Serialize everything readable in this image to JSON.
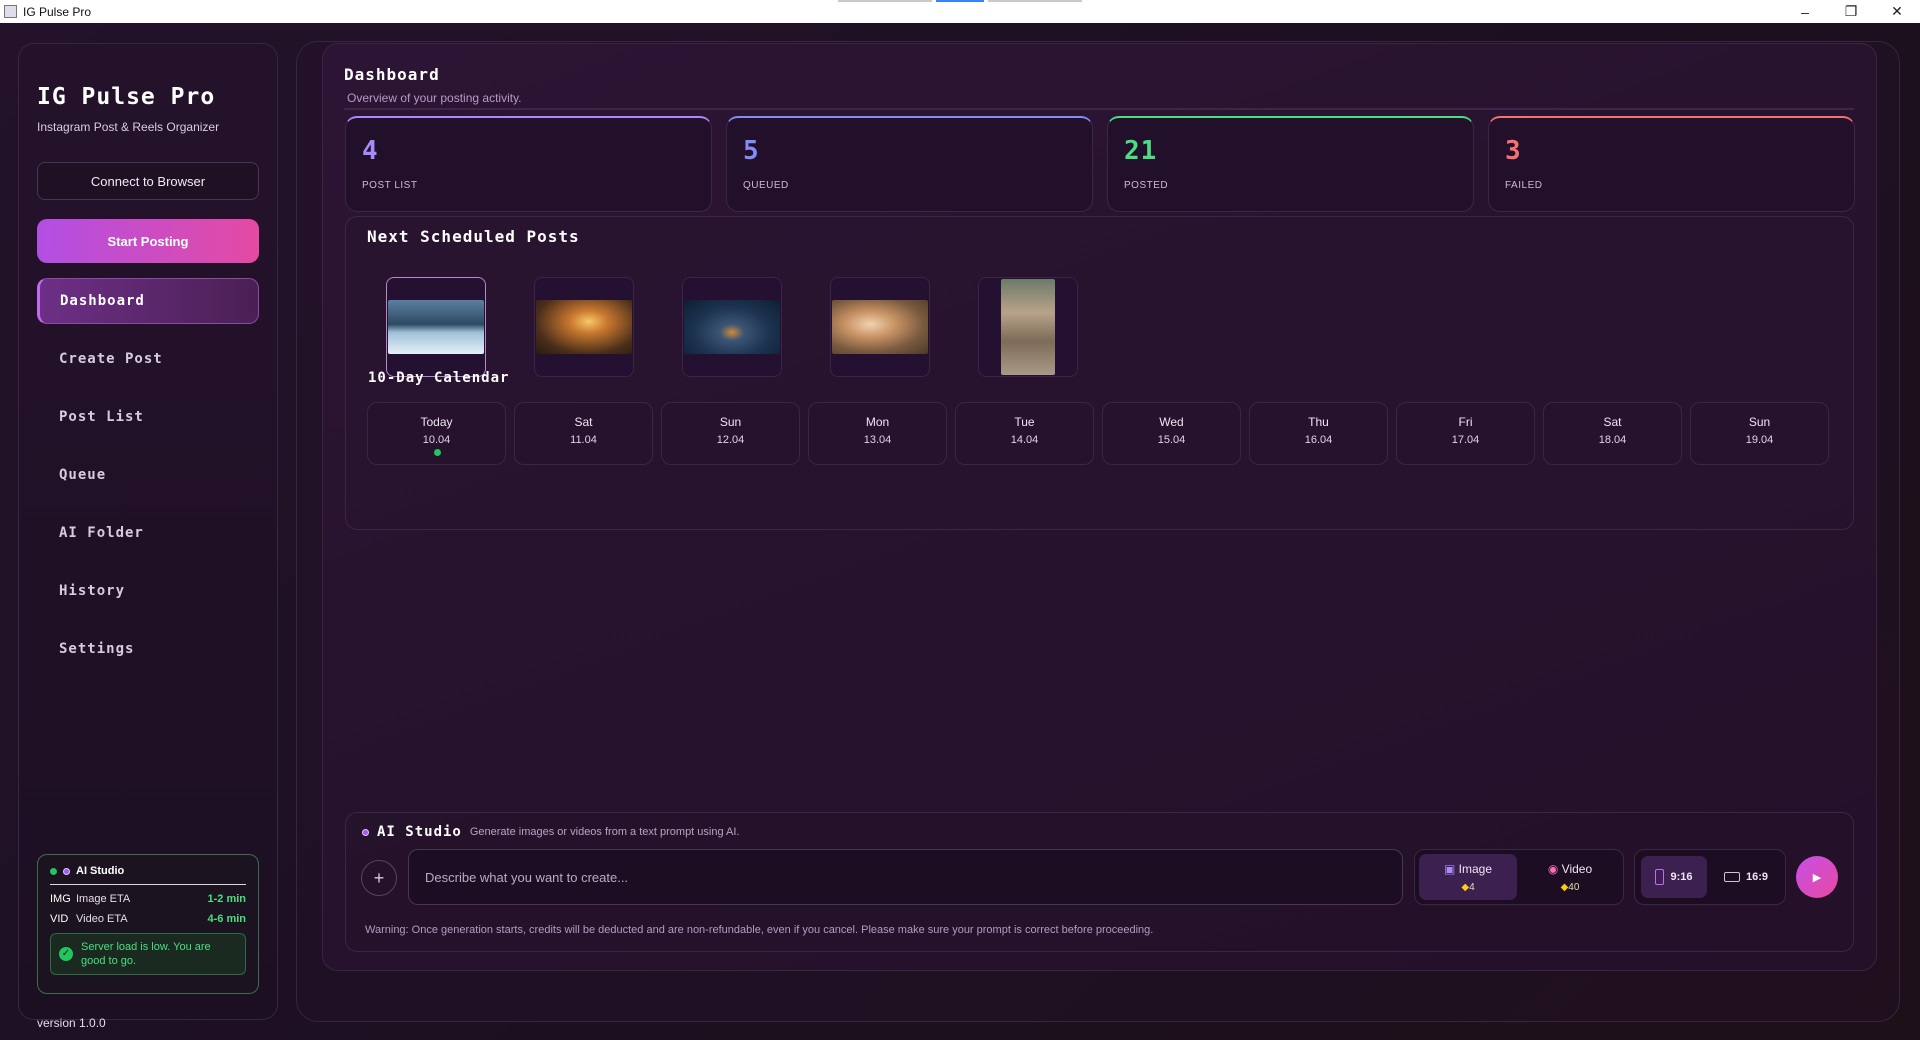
{
  "window": {
    "title": "IG Pulse Pro"
  },
  "sidebar": {
    "brand": "IG Pulse Pro",
    "subtitle": "Instagram Post & Reels Organizer",
    "connect_label": "Connect to Browser",
    "start_label": "Start Posting",
    "nav": [
      {
        "label": "Dashboard",
        "active": true
      },
      {
        "label": "Create Post"
      },
      {
        "label": "Post List"
      },
      {
        "label": "Queue"
      },
      {
        "label": "AI Folder"
      },
      {
        "label": "History"
      },
      {
        "label": "Settings"
      }
    ],
    "ai_card": {
      "title": "AI Studio",
      "rows": [
        {
          "tag": "IMG",
          "label": "Image ETA",
          "value": "1-2 min"
        },
        {
          "tag": "VID",
          "label": "Video ETA",
          "value": "4-6 min"
        }
      ],
      "status": "Server load is low. You are good to go."
    },
    "version": "version 1.0.0"
  },
  "dashboard": {
    "title": "Dashboard",
    "subtitle": "Overview of your posting activity.",
    "stats": [
      {
        "value": "4",
        "label": "POST LIST",
        "color": "#a78bfa"
      },
      {
        "value": "5",
        "label": "QUEUED",
        "color": "#818cf8"
      },
      {
        "value": "21",
        "label": "POSTED",
        "color": "#4ade80"
      },
      {
        "value": "3",
        "label": "FAILED",
        "color": "#f87171"
      }
    ],
    "scheduled_title": "Next Scheduled Posts",
    "thumbnails": [
      {
        "icon": "snow-cabin-image"
      },
      {
        "icon": "sunlit-forest-image"
      },
      {
        "icon": "night-cabin-image"
      },
      {
        "icon": "kitten-image"
      },
      {
        "icon": "child-with-cat-image"
      }
    ],
    "calendar_title": "10-Day Calendar",
    "calendar": [
      {
        "day": "Today",
        "date": "10.04",
        "today": true
      },
      {
        "day": "Sat",
        "date": "11.04"
      },
      {
        "day": "Sun",
        "date": "12.04"
      },
      {
        "day": "Mon",
        "date": "13.04"
      },
      {
        "day": "Tue",
        "date": "14.04"
      },
      {
        "day": "Wed",
        "date": "15.04"
      },
      {
        "day": "Thu",
        "date": "16.04"
      },
      {
        "day": "Fri",
        "date": "17.04"
      },
      {
        "day": "Sat",
        "date": "18.04"
      },
      {
        "day": "Sun",
        "date": "19.04"
      }
    ]
  },
  "studio": {
    "title": "AI Studio",
    "subtitle": "Generate images or videos from a text prompt using AI.",
    "placeholder": "Describe what you want to create...",
    "modes": [
      {
        "label": "Image",
        "cost": "4",
        "active": true
      },
      {
        "label": "Video",
        "cost": "40"
      }
    ],
    "ratios": [
      {
        "label": "9:16",
        "active": true
      },
      {
        "label": "16:9"
      }
    ],
    "warning": "Warning: Once generation starts, credits will be deducted and are non-refundable, even if you cancel. Please make sure your prompt is correct before proceeding."
  }
}
